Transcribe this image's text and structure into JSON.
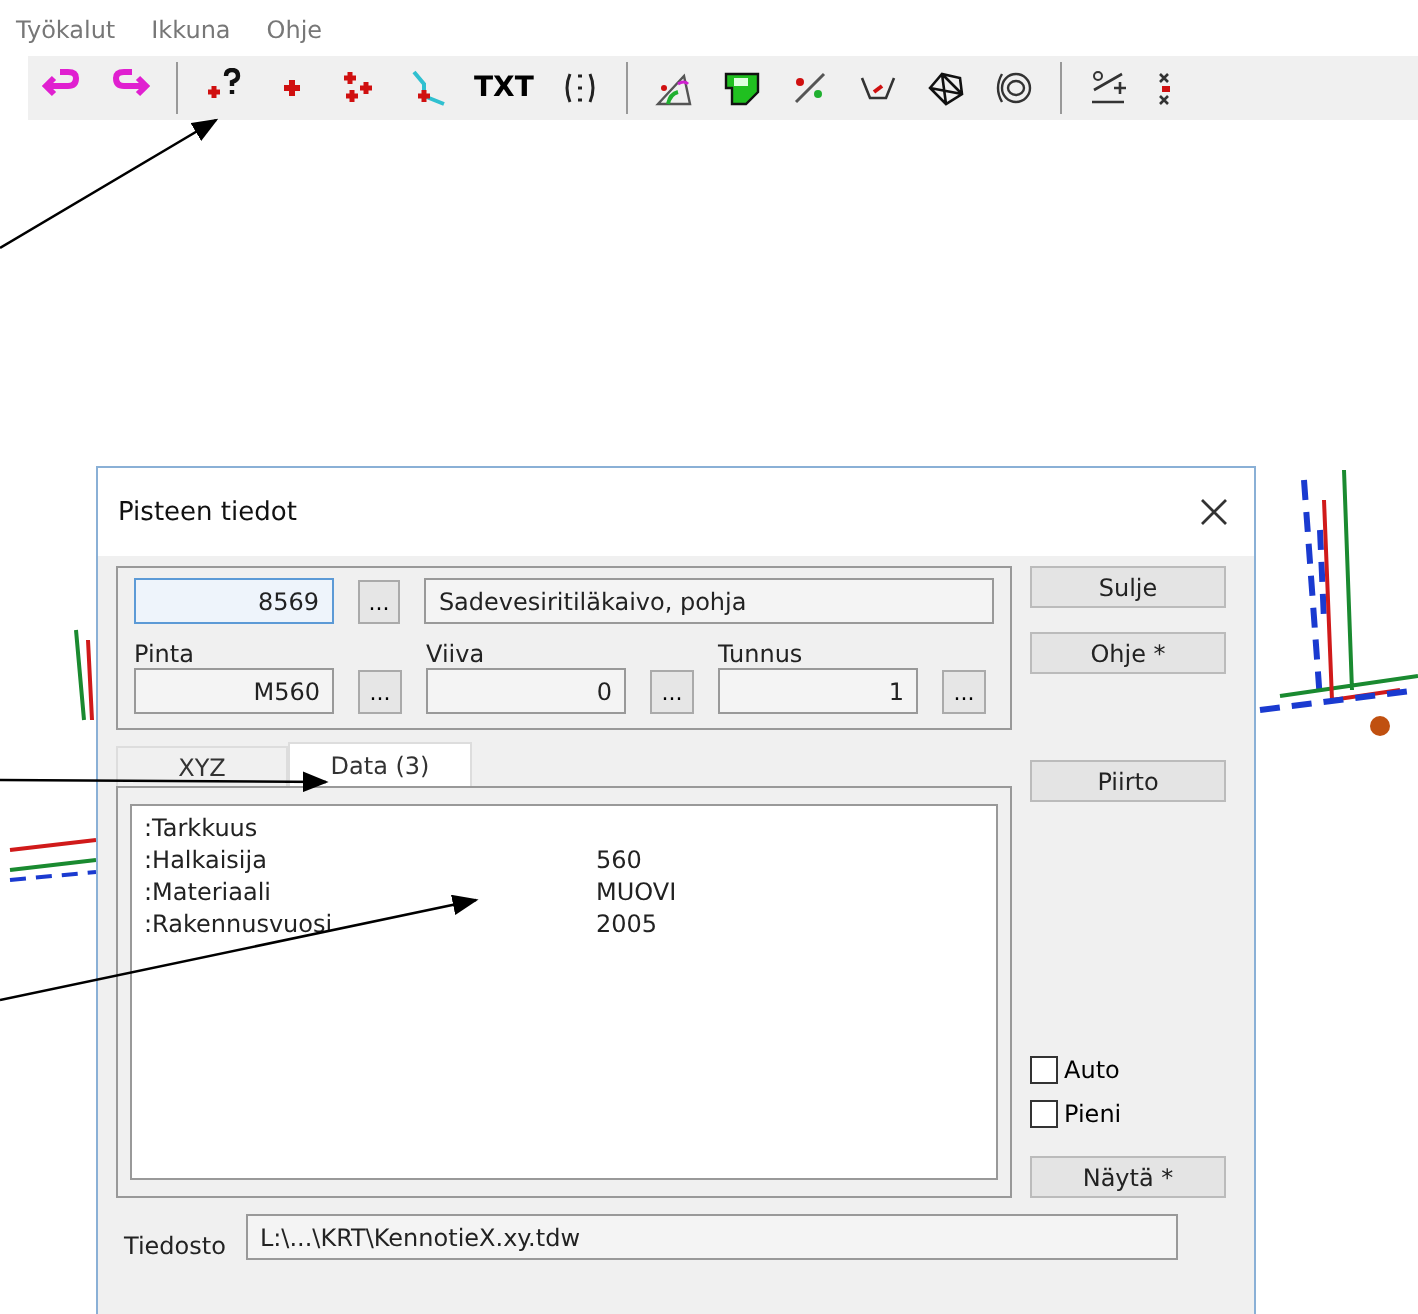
{
  "menu": [
    "Työkalut",
    "Ikkuna",
    "Ohje"
  ],
  "toolbar": [
    {
      "kind": "undo"
    },
    {
      "kind": "redo"
    },
    {
      "kind": "sep"
    },
    {
      "kind": "query"
    },
    {
      "kind": "point"
    },
    {
      "kind": "points"
    },
    {
      "kind": "linepoint"
    },
    {
      "kind": "text",
      "label": "TXT"
    },
    {
      "kind": "numbering"
    },
    {
      "kind": "sep"
    },
    {
      "kind": "angle"
    },
    {
      "kind": "area"
    },
    {
      "kind": "distance"
    },
    {
      "kind": "dimension"
    },
    {
      "kind": "tin"
    },
    {
      "kind": "contour"
    },
    {
      "kind": "sep"
    },
    {
      "kind": "coords"
    },
    {
      "kind": "cut"
    }
  ],
  "dialog": {
    "title": "Pisteen tiedot",
    "number": "8569",
    "number_browse": "...",
    "description": "Sadevesiritiläkaivo, pohja",
    "fields": [
      {
        "label": "Pinta",
        "value": "M560",
        "browse": "..."
      },
      {
        "label": "Viiva",
        "value": "0",
        "browse": "..."
      },
      {
        "label": "Tunnus",
        "value": "1",
        "browse": "..."
      }
    ],
    "tabs": [
      {
        "label": "XYZ",
        "selected": false
      },
      {
        "label": "Data (3)",
        "selected": true
      }
    ],
    "data_rows": [
      {
        "key": ":Tarkkuus"
      },
      {
        "key": ":Halkaisija",
        "value": "560"
      },
      {
        "key": ":Materiaali",
        "value": "MUOVI"
      },
      {
        "key": ":Rakennusvuosi",
        "value": "2005"
      }
    ],
    "buttons": [
      "Sulje",
      "Ohje *",
      "Piirto"
    ],
    "checkboxes": [
      {
        "label": "Auto",
        "checked": false
      },
      {
        "label": "Pieni",
        "checked": false
      }
    ],
    "show_button": "Näytä *",
    "file_label": "Tiedosto",
    "file_value": "L:\\...\\KRT\\KennotieX.xy.tdw"
  }
}
